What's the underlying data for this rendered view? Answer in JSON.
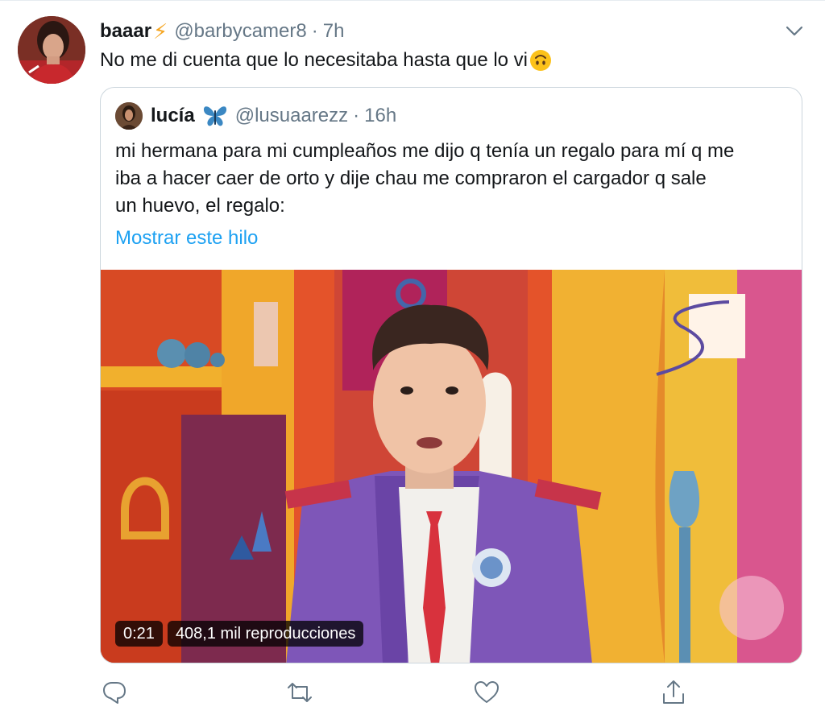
{
  "tweet": {
    "author_name": "baaar",
    "author_badge": "⚡",
    "handle": "@barbycamer8",
    "separator": "·",
    "time": "7h",
    "text": "No me di cuenta que lo necesitaba hasta que lo vi",
    "emoji_icon": "upside-down-face-icon"
  },
  "quoted_tweet": {
    "author_name": "lucía",
    "badge_icon": "butterfly-icon",
    "handle": "@lusuaarezz",
    "separator": "·",
    "time": "16h",
    "text_lines": [
      "mi hermana para mi cumpleaños me dijo q tenía un regalo para mí q me",
      "iba a hacer caer de orto y dije chau me compraron el cargador q sale",
      "un huevo, el regalo:"
    ],
    "show_thread_link": "Mostrar este hilo",
    "video": {
      "duration": "0:21",
      "views": "408,1 mil reproducciones"
    }
  },
  "actions": {
    "reply_icon": "reply-icon",
    "retweet_icon": "retweet-icon",
    "like_icon": "heart-icon",
    "share_icon": "share-icon"
  },
  "colors": {
    "link": "#1da1f2",
    "secondary_text": "#657786",
    "border": "#ccd6dd"
  }
}
